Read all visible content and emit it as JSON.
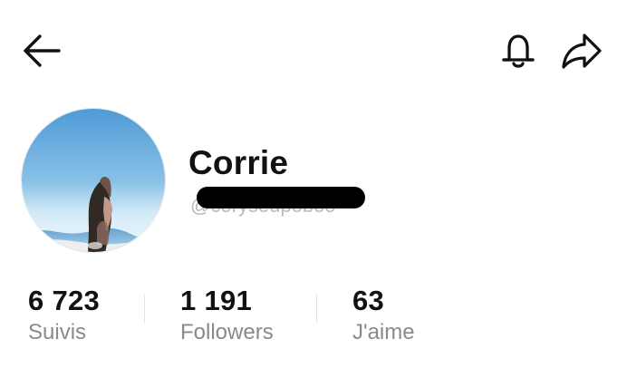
{
  "header": {
    "back_icon": "back-arrow-icon",
    "bell_icon": "bell-icon",
    "share_icon": "share-icon"
  },
  "profile": {
    "name": "Corrie",
    "username": "@coryseupoboo",
    "avatar": "profile-photo"
  },
  "stats": [
    {
      "value": "6 723",
      "label": "Suivis"
    },
    {
      "value": "1 191",
      "label": "Followers"
    },
    {
      "value": "63",
      "label": "J'aime"
    }
  ],
  "colors": {
    "text": "#111111",
    "muted": "#8a8a8a",
    "redaction": "#000000"
  }
}
